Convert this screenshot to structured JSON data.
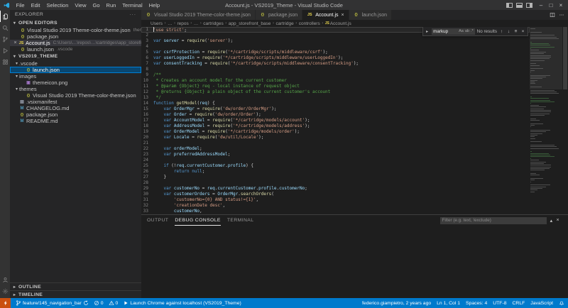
{
  "title_bar": {
    "title": "Account.js - VS2019_Theme - Visual Studio Code",
    "menus": [
      "File",
      "Edit",
      "Selection",
      "View",
      "Go",
      "Run",
      "Terminal",
      "Help"
    ],
    "window_controls": [
      "minimize",
      "maximize",
      "close"
    ]
  },
  "activity_bar": {
    "items": [
      {
        "name": "explorer",
        "active": true
      },
      {
        "name": "search",
        "active": false
      },
      {
        "name": "source-control",
        "active": false
      },
      {
        "name": "run-debug",
        "active": false
      },
      {
        "name": "extensions",
        "active": false
      }
    ],
    "bottom_items": [
      {
        "name": "account",
        "active": false
      },
      {
        "name": "settings",
        "active": false
      }
    ]
  },
  "sidebar": {
    "title": "EXPLORER",
    "open_editors": {
      "header": "OPEN EDITORS",
      "items": [
        {
          "label": "Visual Studio 2019 Theme-color-theme.json",
          "detail": "themes",
          "icon": "json",
          "active": false
        },
        {
          "label": "package.json",
          "detail": "",
          "icon": "json",
          "active": false
        },
        {
          "label": "Account.js",
          "detail": "C:\\Users\\…\\repos\\…\\cartridges\\app_storefront_base…",
          "icon": "js",
          "active": true
        },
        {
          "label": "launch.json",
          "detail": ".vscode",
          "icon": "json",
          "active": false
        }
      ]
    },
    "tree": {
      "header": "VS2019_THEME",
      "items": [
        {
          "label": ".vscode",
          "type": "folder",
          "indent": 0
        },
        {
          "label": "launch.json",
          "type": "json",
          "indent": 1,
          "selected": true
        },
        {
          "label": "images",
          "type": "folder",
          "indent": 0
        },
        {
          "label": "themeicon.png",
          "type": "image",
          "indent": 1
        },
        {
          "label": "themes",
          "type": "folder",
          "indent": 0
        },
        {
          "label": "Visual Studio 2019 Theme-color-theme.json",
          "type": "json",
          "indent": 1
        },
        {
          "label": ".vsixmanifest",
          "type": "file",
          "indent": 0
        },
        {
          "label": "CHANGELOG.md",
          "type": "md",
          "indent": 0
        },
        {
          "label": "package.json",
          "type": "json",
          "indent": 0
        },
        {
          "label": "README.md",
          "type": "md",
          "indent": 0
        }
      ]
    },
    "bottom_sections": [
      {
        "label": "OUTLINE"
      },
      {
        "label": "TIMELINE"
      }
    ]
  },
  "editor": {
    "tabs": [
      {
        "label": "Visual Studio 2019 Theme-color-theme.json",
        "icon": "json",
        "active": false
      },
      {
        "label": "package.json",
        "icon": "json",
        "active": false
      },
      {
        "label": "Account.js",
        "icon": "js",
        "active": true
      },
      {
        "label": "launch.json",
        "icon": "json",
        "active": false
      }
    ],
    "tab_actions": [
      "split-editor",
      "more-actions"
    ],
    "breadcrumbs": [
      {
        "label": "Users"
      },
      {
        "label": "…"
      },
      {
        "label": "repos"
      },
      {
        "label": "…"
      },
      {
        "label": "cartridges"
      },
      {
        "label": "app_storefront_base"
      },
      {
        "label": "cartridge"
      },
      {
        "label": "controllers"
      },
      {
        "label": "Account.js",
        "icon": "js"
      }
    ],
    "find": {
      "query": "markup",
      "toggles": [
        "Aa",
        "ab",
        ".*"
      ],
      "result_text": "No results"
    },
    "code_lines": [
      "'use strict';",
      "",
      "var server = require('server');",
      "",
      "var csrfProtection = require('*/cartridge/scripts/middleware/csrf');",
      "var userLoggedIn = require('*/cartridge/scripts/middleware/userLoggedIn');",
      "var consentTracking = require('*/cartridge/scripts/middleware/consentTracking');",
      "",
      "/**",
      " * Creates an account model for the current customer",
      " * @param {Object} req - local instance of request object",
      " * @returns {Object} a plain object of the current customer's account",
      " */",
      "function getModel(req) {",
      "    var OrderMgr = require('dw/order/OrderMgr');",
      "    var Order = require('dw/order/Order');",
      "    var AccountModel = require('*/cartridge/models/account');",
      "    var AddressModel = require('*/cartridge/models/address');",
      "    var OrderModel = require('*/cartridge/models/order');",
      "    var Locale = require('dw/util/Locale');",
      "",
      "    var orderModel;",
      "    var preferredAddressModel;",
      "",
      "    if (!req.currentCustomer.profile) {",
      "        return null;",
      "    }",
      "",
      "    var customerNo = req.currentCustomer.profile.customerNo;",
      "    var customerOrders = OrderMgr.searchOrders(",
      "        'customerNo={0} AND status!={1}',",
      "        'creationDate desc',",
      "        customerNo,"
    ]
  },
  "panel": {
    "tabs": [
      {
        "label": "OUTPUT",
        "active": false
      },
      {
        "label": "DEBUG CONSOLE",
        "active": true
      },
      {
        "label": "TERMINAL",
        "active": false
      }
    ],
    "filter_placeholder": "Filter (e.g. text, !exclude)"
  },
  "status_bar": {
    "left": [
      {
        "name": "remote",
        "icon": "remote",
        "label": ""
      },
      {
        "name": "git-branch",
        "icon": "branch",
        "label": "feature/145_navigation_bar",
        "extra_icon": "sync"
      },
      {
        "name": "errors",
        "icon": "error",
        "label": "0"
      },
      {
        "name": "warnings",
        "icon": "warning",
        "label": "0"
      },
      {
        "name": "debug-launch",
        "icon": "play",
        "label": "Launch Chrome against localhost (VS2019_Theme)"
      }
    ],
    "right": [
      {
        "name": "author-info",
        "label": "federico.giampietro, 2 years ago"
      },
      {
        "name": "cursor-position",
        "label": "Ln 1, Col 1"
      },
      {
        "name": "indentation",
        "label": "Spaces: 4"
      },
      {
        "name": "encoding",
        "label": "UTF-8"
      },
      {
        "name": "eol",
        "label": "CRLF"
      },
      {
        "name": "language-mode",
        "label": "JavaScript"
      },
      {
        "name": "notifications",
        "icon": "bell",
        "label": ""
      }
    ]
  },
  "colors": {
    "status_bar": "#007acc",
    "list_selection": "#094771",
    "remote_badge": "#ca5010"
  }
}
